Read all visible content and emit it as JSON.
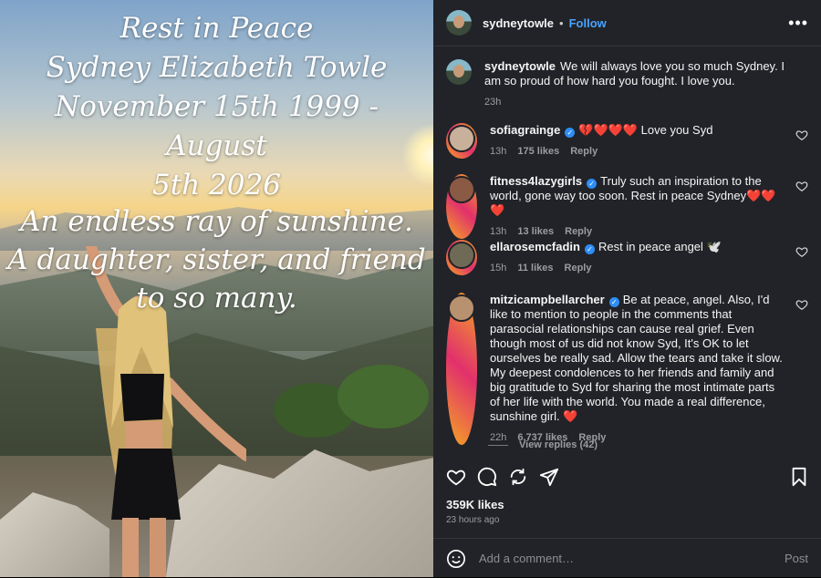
{
  "photo": {
    "caption_lines_1": [
      "Rest in Peace",
      "Sydney Elizabeth Towle",
      "November 15th 1999 - August",
      "5th 2026"
    ],
    "caption_lines_2": [
      "An endless ray of sunshine.",
      "A daughter, sister, and friend",
      "to so many."
    ]
  },
  "header": {
    "username": "sydneytowle",
    "separator": "•",
    "follow_label": "Follow",
    "more_label": "•••"
  },
  "caption_post": {
    "username": "sydneytowle",
    "text": "We will always love you so much Sydney. I am so proud of how hard you fought. I love you.",
    "time": "23h"
  },
  "comments": [
    {
      "username": "sofiagrainge",
      "text": "💔❤️❤️❤️ Love you Syd",
      "time": "13h",
      "likes": "175 likes",
      "reply": "Reply"
    },
    {
      "username": "fitness4lazygirls",
      "text": "Truly such an inspiration to the world, gone way too soon. Rest in peace Sydney❤️❤️❤️",
      "time": "13h",
      "likes": "13 likes",
      "reply": "Reply"
    },
    {
      "username": "ellarosemcfadin",
      "text": "Rest in peace angel 🕊️",
      "time": "15h",
      "likes": "11 likes",
      "reply": "Reply"
    },
    {
      "username": "mitzicampbellarcher",
      "text": "Be at peace, angel. Also, I'd like to mention to people in the comments that parasocial relationships can cause real grief. Even though most of us did not know Syd, It's OK to let ourselves be really sad. Allow the tears and take it slow. My deepest condolences to her friends and family and big gratitude to Syd for sharing the most intimate parts of her life with the world. You made a real difference, sunshine girl. ❤️",
      "time": "22h",
      "likes": "6,737 likes",
      "reply": "Reply"
    }
  ],
  "view_replies": "View replies (42)",
  "stats": {
    "likes": "359K likes",
    "posted": "23 hours ago"
  },
  "add_comment": {
    "placeholder": "Add a comment…",
    "post_label": "Post"
  },
  "colors": {
    "panel_bg": "#212328",
    "link_blue": "#4aa3ff",
    "verified_blue": "#2d8ef7",
    "muted": "#9a9ca1"
  },
  "icons": [
    "heart-icon",
    "comment-icon",
    "share-icon",
    "send-icon",
    "bookmark-icon",
    "emoji-icon",
    "verified-icon",
    "more-icon"
  ]
}
